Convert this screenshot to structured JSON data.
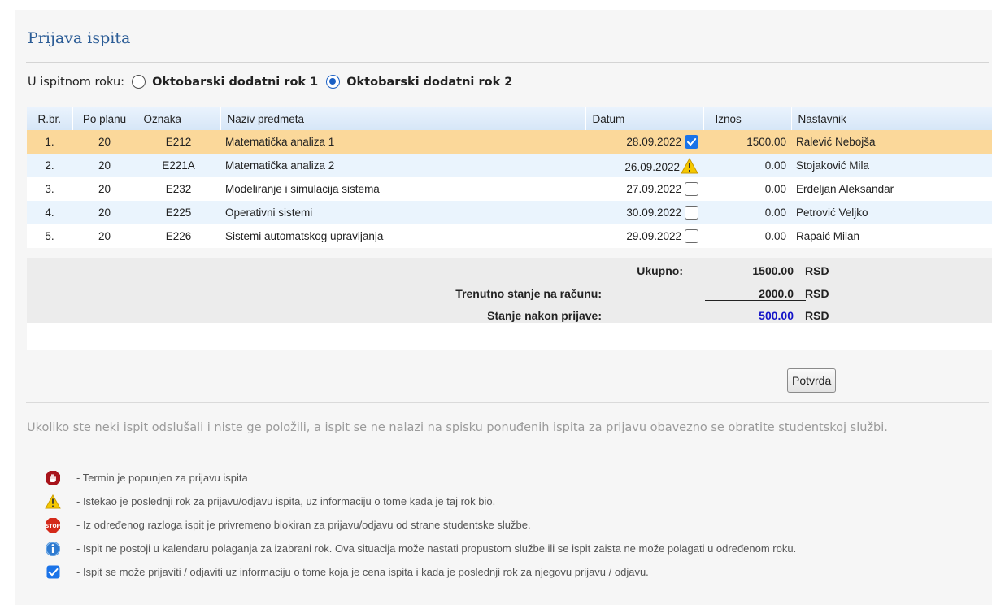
{
  "page": {
    "title": "Prijava ispita"
  },
  "exam_period": {
    "label": "U ispitnom roku:",
    "options": [
      "Oktobarski dodatni rok 1",
      "Oktobarski dodatni rok 2"
    ],
    "selected": "Oktobarski dodatni rok 2"
  },
  "table": {
    "columns": [
      "R.br.",
      "Po planu",
      "Oznaka",
      "Naziv predmeta",
      "Datum",
      "Iznos",
      "Nastavnik"
    ],
    "rows": [
      {
        "rbr": "1.",
        "po_planu": "20",
        "oznaka": "E212",
        "naziv": "Matematička analiza 1",
        "datum": "28.09.2022",
        "status": "checked",
        "iznos": "1500.00",
        "nastavnik": "Ralević Nebojša"
      },
      {
        "rbr": "2.",
        "po_planu": "20",
        "oznaka": "E221A",
        "naziv": "Matematička analiza 2",
        "datum": "26.09.2022",
        "status": "warning",
        "iznos": "0.00",
        "nastavnik": "Stojaković Mila"
      },
      {
        "rbr": "3.",
        "po_planu": "20",
        "oznaka": "E232",
        "naziv": "Modeliranje i simulacija sistema",
        "datum": "27.09.2022",
        "status": "unchecked",
        "iznos": "0.00",
        "nastavnik": "Erdeljan Aleksandar"
      },
      {
        "rbr": "4.",
        "po_planu": "20",
        "oznaka": "E225",
        "naziv": "Operativni sistemi",
        "datum": "30.09.2022",
        "status": "unchecked",
        "iznos": "0.00",
        "nastavnik": "Petrović Veljko"
      },
      {
        "rbr": "5.",
        "po_planu": "20",
        "oznaka": "E226",
        "naziv": "Sistemi automatskog upravljanja",
        "datum": "29.09.2022",
        "status": "unchecked",
        "iznos": "0.00",
        "nastavnik": "Rapaić Milan"
      }
    ]
  },
  "summary": {
    "ukupno_label": "Ukupno:",
    "ukupno_value": "1500.00",
    "stanje_label": "Trenutno stanje na računu:",
    "stanje_value": "2000.0",
    "nakon_label": "Stanje nakon prijave:",
    "nakon_value": "500.00",
    "currency": "RSD"
  },
  "confirm_button": "Potvrda",
  "note": "Ukoliko ste neki ispit odslušali i niste ge položili, a ispit se ne nalazi na spisku ponuđenih ispita za prijavu obavezno se obratite studentskoj službi.",
  "legend": [
    {
      "icon": "hand-stop-icon",
      "text": "- Termin je popunjen za prijavu ispita"
    },
    {
      "icon": "warning-icon",
      "text": "- Istekao je poslednji rok za prijavu/odjavu ispita, uz informaciju o tome kada je taj rok bio."
    },
    {
      "icon": "stop-sign-icon",
      "text": "- Iz određenog razloga ispit je privremeno blokiran za prijavu/odjavu od strane studentske službe."
    },
    {
      "icon": "info-icon",
      "text": "- Ispit ne postoji u kalendaru polaganja za izabrani rok. Ova situacija može nastati propustom službe ili se ispit zaista ne može polagati u određenom roku."
    },
    {
      "icon": "checkbox-checked-icon",
      "text": "- Ispit se može prijaviti / odjaviti uz informaciju o tome koja je cena ispita i kada je poslednji rok za njegovu prijavu / odjavu."
    }
  ],
  "colors": {
    "title": "#2b5c96",
    "selected_row": "#fbd89a",
    "alt_row": "#eaf4fd",
    "accent_blue": "#1a73e8",
    "balance_after": "#1414c8"
  }
}
